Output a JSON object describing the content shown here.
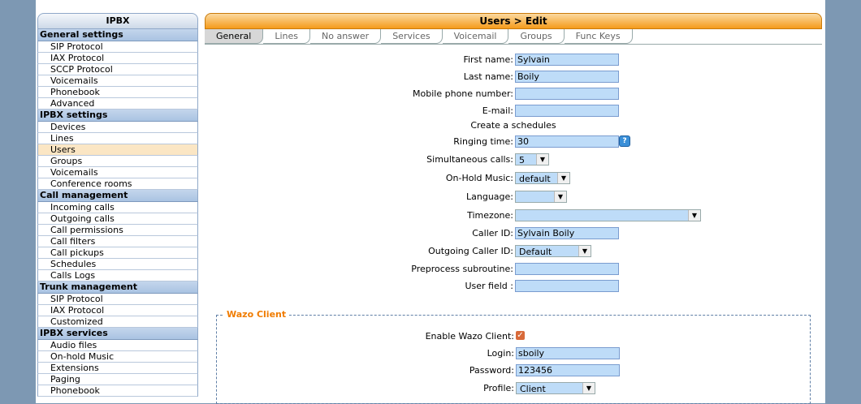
{
  "sidebar": {
    "title": "IPBX",
    "sections": [
      {
        "title": "General settings",
        "items": [
          "SIP Protocol",
          "IAX Protocol",
          "SCCP Protocol",
          "Voicemails",
          "Phonebook",
          "Advanced"
        ]
      },
      {
        "title": "IPBX settings",
        "items": [
          "Devices",
          "Lines",
          "Users",
          "Groups",
          "Voicemails",
          "Conference rooms"
        ]
      },
      {
        "title": "Call management",
        "items": [
          "Incoming calls",
          "Outgoing calls",
          "Call permissions",
          "Call filters",
          "Call pickups",
          "Schedules",
          "Calls Logs"
        ]
      },
      {
        "title": "Trunk management",
        "items": [
          "SIP Protocol",
          "IAX Protocol",
          "Customized"
        ]
      },
      {
        "title": "IPBX services",
        "items": [
          "Audio files",
          "On-hold Music",
          "Extensions",
          "Paging",
          "Phonebook"
        ]
      }
    ],
    "active_item": "Users"
  },
  "main": {
    "title": "Users > Edit",
    "tabs": [
      "General",
      "Lines",
      "No answer",
      "Services",
      "Voicemail",
      "Groups",
      "Func Keys"
    ],
    "active_tab": "General"
  },
  "form": {
    "first_name": {
      "label": "First name:",
      "value": "Sylvain"
    },
    "last_name": {
      "label": "Last name:",
      "value": "Boily"
    },
    "mobile": {
      "label": "Mobile phone number:",
      "value": ""
    },
    "email": {
      "label": "E-mail:",
      "value": ""
    },
    "create_schedules": "Create a schedules",
    "ringing_time": {
      "label": "Ringing time:",
      "value": "30"
    },
    "simultaneous_calls": {
      "label": "Simultaneous calls:",
      "value": "5"
    },
    "onhold_music": {
      "label": "On-Hold Music:",
      "value": "default"
    },
    "language": {
      "label": "Language:",
      "value": ""
    },
    "timezone": {
      "label": "Timezone:",
      "value": ""
    },
    "caller_id": {
      "label": "Caller ID:",
      "value": "Sylvain Boily"
    },
    "outgoing_caller_id": {
      "label": "Outgoing Caller ID:",
      "value": "Default"
    },
    "preprocess": {
      "label": "Preprocess subroutine:",
      "value": ""
    },
    "user_field": {
      "label": "User field :",
      "value": ""
    }
  },
  "wazo": {
    "legend": "Wazo Client",
    "enable": {
      "label": "Enable Wazo Client:",
      "checked": true
    },
    "login": {
      "label": "Login:",
      "value": "sboily"
    },
    "password": {
      "label": "Password:",
      "value": "123456"
    },
    "profile": {
      "label": "Profile:",
      "value": "Client"
    }
  },
  "colors": {
    "accent": "#f59b1a",
    "input_bg": "#bedcf8",
    "legend": "#f07c00"
  }
}
